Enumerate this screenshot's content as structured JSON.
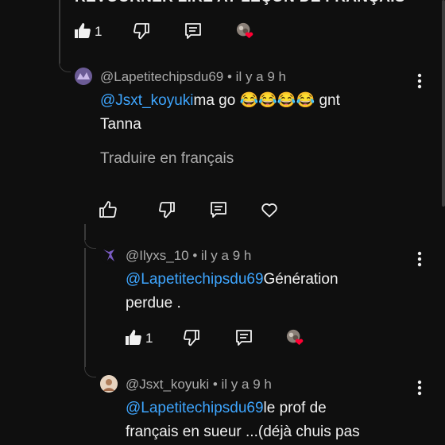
{
  "top": {
    "cut_text": "REVOURNER LIRE AT LEÇON DE FRANÇAIS",
    "like_count": "1"
  },
  "comment1": {
    "author": "@Lapetitechipsdu69",
    "dot_time": "• il y a 9 h",
    "mention": "@Jsxt_koyuki",
    "text": "ma go 😂😂😂😂 gnt",
    "text2": "Tanna",
    "translate": "Traduire en français"
  },
  "comment2": {
    "author": "@Ilyxs_10",
    "dot_time": "• il y a 9 h",
    "mention": "@Lapetitechipsdu69",
    "text": "Génération",
    "text2": "perdue .",
    "like_count": "1"
  },
  "comment3": {
    "author": "@Jsxt_koyuki",
    "dot_time": "• il y a 9 h",
    "mention": "@Lapetitechipsdu69",
    "text": "le prof de",
    "text2": "français en sueur ...(déjà chuis pas"
  },
  "colors": {
    "background": "#0f0f0f",
    "mention": "#3ea6ff",
    "heart": "#ff0033",
    "meta": "#aaaaaa"
  }
}
